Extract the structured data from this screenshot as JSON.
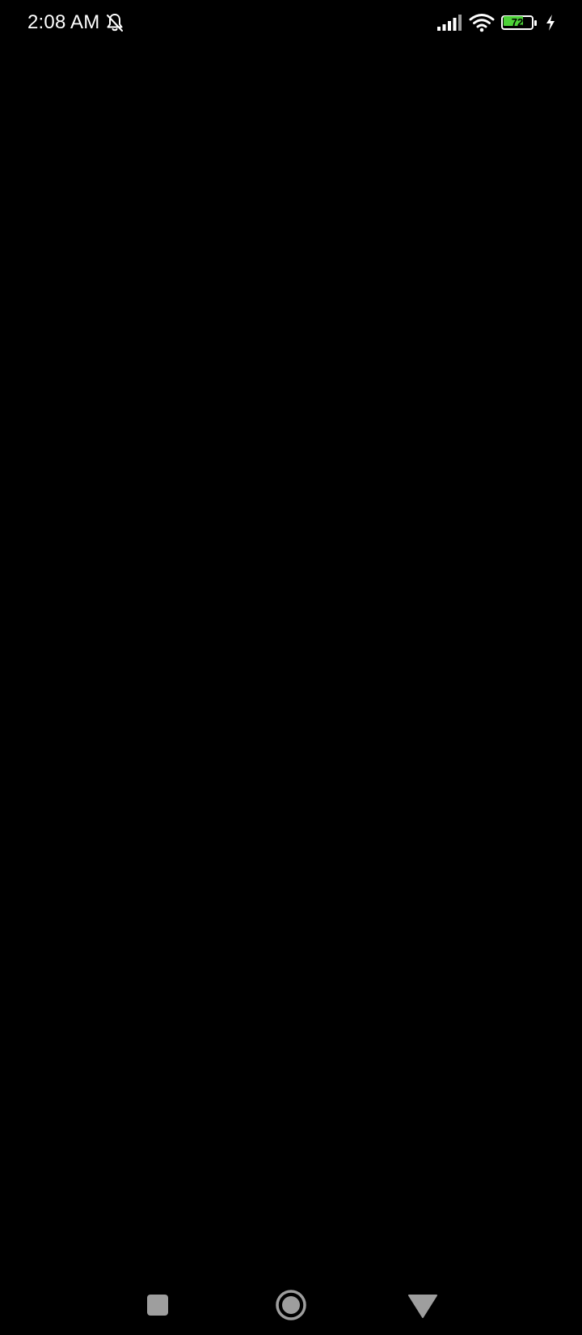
{
  "status_bar": {
    "time": "2:08 AM",
    "battery_level": "72",
    "battery_fraction": 0.72,
    "battery_color": "#4cd137",
    "icons": [
      "notifications-muted-icon",
      "signal-icon",
      "wifi-icon",
      "battery-icon",
      "charging-bolt-icon"
    ]
  },
  "nav_bar": {
    "buttons": [
      "recents-button",
      "home-button",
      "back-button"
    ],
    "color": "#9e9e9e"
  },
  "content": {
    "background": "#000000"
  }
}
